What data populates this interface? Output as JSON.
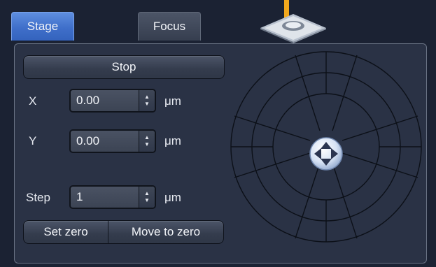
{
  "tabs": [
    {
      "label": "Stage",
      "active": true
    },
    {
      "label": "Focus",
      "active": false
    }
  ],
  "stage_icon": {
    "name": "microscope-stage-icon"
  },
  "buttons": {
    "stop": "Stop",
    "set_zero": "Set zero",
    "move_to_zero": "Move to zero"
  },
  "fields": {
    "x": {
      "label": "X",
      "value": "0.00",
      "unit": "μm"
    },
    "y": {
      "label": "Y",
      "value": "0.00",
      "unit": "μm"
    },
    "step": {
      "label": "Step",
      "value": "1",
      "unit": "μm"
    }
  },
  "joystick": {
    "name": "stage-joystick",
    "center_icon": "four-way-arrow-icon"
  },
  "colors": {
    "background": "#1b2233",
    "panel": "#2a3245",
    "active_tab": "#4a7ad4",
    "stage_beam": "#f2a81d"
  }
}
